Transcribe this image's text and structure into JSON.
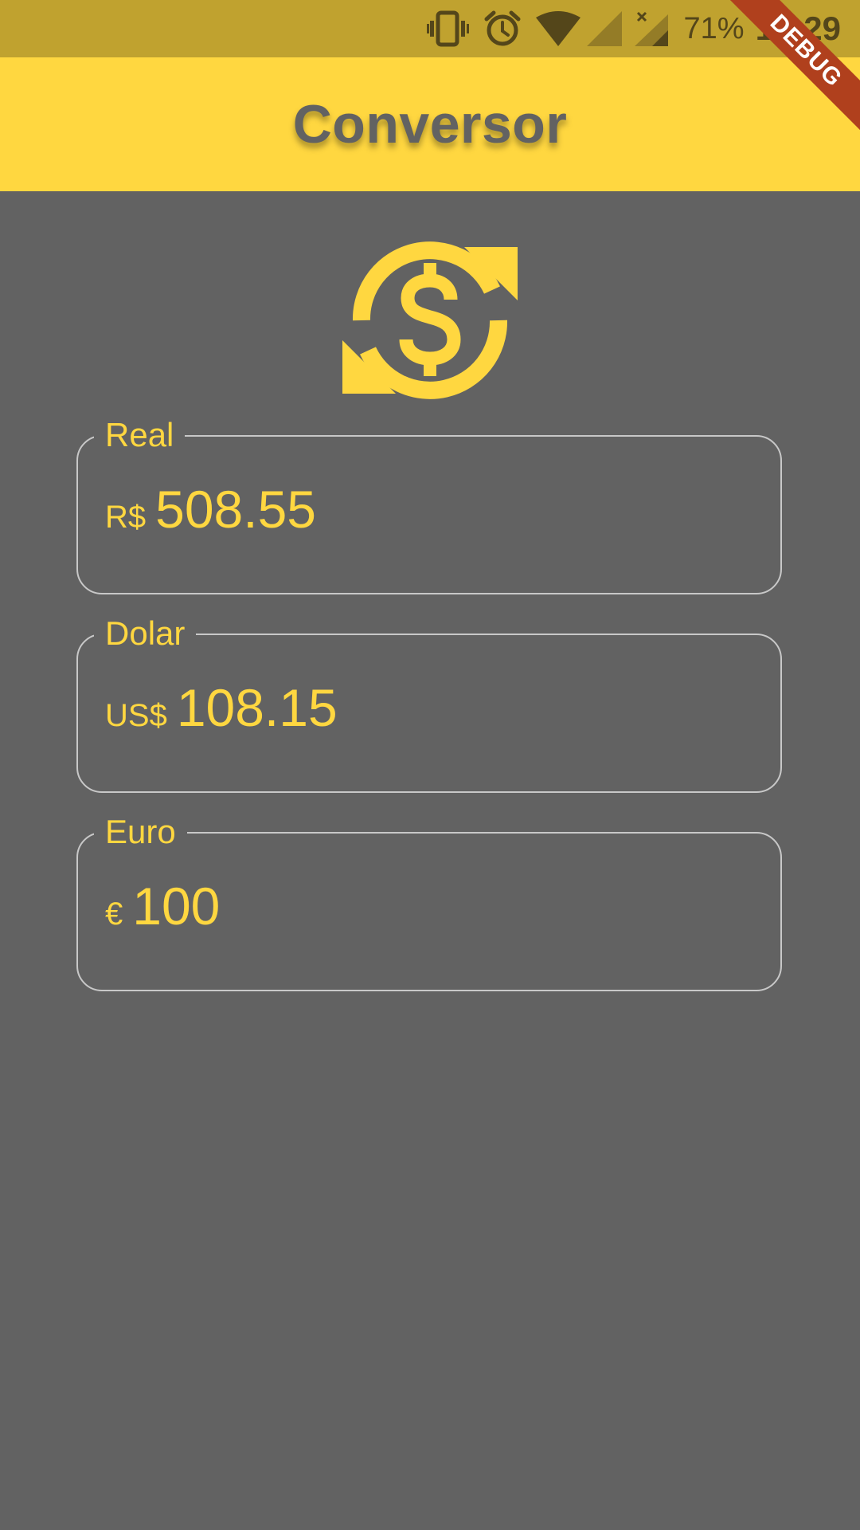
{
  "status_bar": {
    "battery": "71%",
    "time": "10:29",
    "icons": [
      "vibrate-icon",
      "alarm-icon",
      "wifi-icon",
      "signal-icon",
      "signal-no-data-icon"
    ]
  },
  "app_bar": {
    "title": "Conversor"
  },
  "debug_banner": "DEBUG",
  "hero_icon": "currency-exchange-icon",
  "fields": {
    "real": {
      "label": "Real",
      "prefix": "R$",
      "value": "508.55"
    },
    "dolar": {
      "label": "Dolar",
      "prefix": "US$",
      "value": "108.15"
    },
    "euro": {
      "label": "Euro",
      "prefix": "€",
      "value": "100"
    }
  },
  "colors": {
    "accent": "#ffd740",
    "background": "#626262",
    "status_bar": "#c0a22f",
    "field_border": "#c8c8c8",
    "debug_banner": "#b0401d"
  }
}
